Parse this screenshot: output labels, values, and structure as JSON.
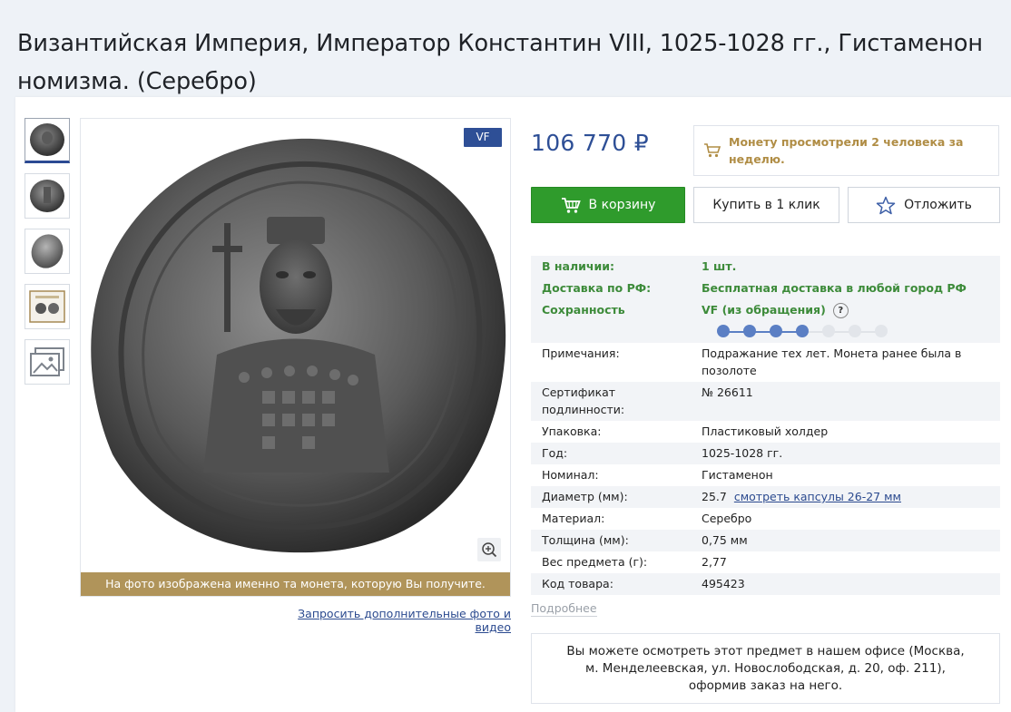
{
  "page": {
    "title": "Византийская Империя, Император Константин VIII, 1025-1028 гг., Гистаменон номизма. (Серебро)"
  },
  "gallery": {
    "grade_badge": "VF",
    "caption": "На фото изображена именно та монета, которую Вы получите.",
    "request_link": "Запросить дополнительные фото и видео"
  },
  "product": {
    "price": "106 770 ₽",
    "views_notice": "Монету просмотрели 2 человека за неделю.",
    "buttons": {
      "cart": "В корзину",
      "one_click": "Купить в 1 клик",
      "later": "Отложить"
    }
  },
  "specs": {
    "availability": {
      "label": "В наличии:",
      "value": "1 шт."
    },
    "delivery": {
      "label": "Доставка по РФ:",
      "value": "Бесплатная доставка в любой город РФ"
    },
    "condition": {
      "label": "Сохранность",
      "value": "VF (из обращения)",
      "help": "?",
      "scale_level": 4,
      "scale_max": 7
    },
    "rows": [
      {
        "label": "Примечания:",
        "value": "Подражание тех лет. Монета ранее была в позолоте"
      },
      {
        "label": "Сертификат подлинности:",
        "value": "№ 26611"
      },
      {
        "label": "Упаковка:",
        "value": "Пластиковый холдер"
      },
      {
        "label": "Год:",
        "value": "1025-1028 гг."
      },
      {
        "label": "Номинал:",
        "value": "Гистаменон"
      },
      {
        "label": "Диаметр (мм):",
        "value": "25.7",
        "link": "смотреть капсулы 26-27 мм"
      },
      {
        "label": "Материал:",
        "value": "Серебро"
      },
      {
        "label": "Толщина (мм):",
        "value": "0,75 мм"
      },
      {
        "label": "Вес предмета (г):",
        "value": "2,77"
      },
      {
        "label": "Код товара:",
        "value": "495423"
      }
    ],
    "more_link": "Подробнее"
  },
  "office": {
    "text": "Вы можете осмотреть этот предмет в нашем офисе (Москва, м. Менделеевская, ул. Новослободская, д. 20, оф. 211), оформив заказ на него."
  },
  "colors": {
    "accent_blue": "#2e4f96",
    "cart_green": "#2f9b2c",
    "gold": "#b0945a",
    "spec_green": "#3d8b3a"
  }
}
